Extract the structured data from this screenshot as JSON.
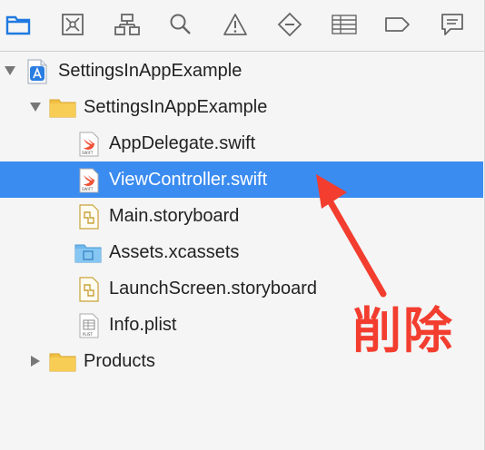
{
  "toolbar": {
    "items": [
      {
        "name": "project-navigator-icon",
        "active": true
      },
      {
        "name": "source-control-navigator-icon"
      },
      {
        "name": "symbol-navigator-icon"
      },
      {
        "name": "find-navigator-icon"
      },
      {
        "name": "issue-navigator-icon"
      },
      {
        "name": "test-navigator-icon"
      },
      {
        "name": "debug-navigator-icon"
      },
      {
        "name": "breakpoint-navigator-icon"
      },
      {
        "name": "report-navigator-icon"
      }
    ],
    "accent": "#1f7ae0"
  },
  "tree": {
    "project": {
      "label": "SettingsInAppExample",
      "icon": "xcode-project-icon"
    },
    "group": {
      "label": "SettingsInAppExample",
      "icon": "folder-icon"
    },
    "files": [
      {
        "label": "AppDelegate.swift",
        "icon": "swift-file-icon"
      },
      {
        "label": "ViewController.swift",
        "icon": "swift-file-icon",
        "selected": true
      },
      {
        "label": "Main.storyboard",
        "icon": "storyboard-file-icon"
      },
      {
        "label": "Assets.xcassets",
        "icon": "assets-folder-icon"
      },
      {
        "label": "LaunchScreen.storyboard",
        "icon": "storyboard-file-icon"
      },
      {
        "label": "Info.plist",
        "icon": "plist-file-icon"
      }
    ],
    "products": {
      "label": "Products",
      "icon": "folder-icon"
    },
    "selection_color": "#3b8cf0"
  },
  "annotation": {
    "text": "削除",
    "color": "#f23d2f"
  }
}
